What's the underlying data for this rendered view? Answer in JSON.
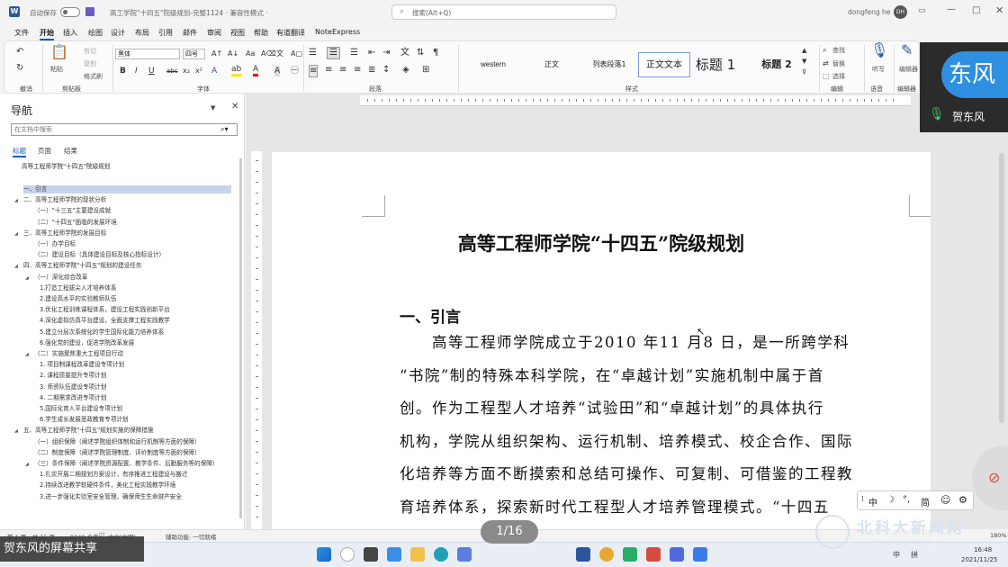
{
  "titlebar": {
    "autosave_label": "自动保存",
    "autosave_state": "关",
    "doc_title": "高工学院\"十四五\"院级规划-完整1124  ·  兼容性模式  ·",
    "search_placeholder": "搜索(Alt+Q)",
    "user_name": "dongfeng he",
    "user_initials": "DH"
  },
  "menu": [
    "文件",
    "开始",
    "插入",
    "绘图",
    "设计",
    "布局",
    "引用",
    "邮件",
    "审阅",
    "视图",
    "帮助",
    "有道翻译",
    "NoteExpress"
  ],
  "menu_active": "开始",
  "ribbon": {
    "undo_group": "撤消",
    "clipboard": {
      "paste": "粘贴",
      "cut": "剪切",
      "copy": "复制",
      "format_painter": "格式刷",
      "label": "剪贴板"
    },
    "font": {
      "name": "黑体",
      "size": "四号",
      "label": "字体",
      "bold": "B",
      "italic": "I",
      "underline": "U",
      "strike": "abc",
      "sub": "x₂",
      "sup": "x²"
    },
    "paragraph": {
      "label": "段落"
    },
    "styles": {
      "label": "样式",
      "items": [
        "western",
        "正文",
        "列表段落1",
        "正文文本",
        "标题 1",
        "标题 2"
      ],
      "selected": "正文文本"
    },
    "editing": {
      "find": "查找",
      "replace": "替换",
      "select": "选择",
      "label": "编辑"
    },
    "voice": {
      "dictate": "听写",
      "label": "语音"
    },
    "editor": {
      "label": "编辑器",
      "btn": "编辑器"
    }
  },
  "nav": {
    "title": "导航",
    "search_placeholder": "在文档中搜索",
    "tabs": [
      "标题",
      "页面",
      "结果"
    ],
    "active_tab": "标题",
    "items": [
      {
        "text": "高等工程师学院\"十四五\"院级规划",
        "level": 0,
        "tri": ""
      },
      {
        "text": "一、引言",
        "level": 1,
        "tri": "",
        "selected": true
      },
      {
        "text": "二、高等工程师学院的现状分析",
        "level": 1,
        "tri": "◢"
      },
      {
        "text": "（一）\"十三五\"主要建设成就",
        "level": 2,
        "tri": ""
      },
      {
        "text": "（二）\"十四五\"面临的发展环境",
        "level": 2,
        "tri": ""
      },
      {
        "text": "三、高等工程师学院的发展目标",
        "level": 1,
        "tri": "◢"
      },
      {
        "text": "（一）办学目标",
        "level": 2,
        "tri": ""
      },
      {
        "text": "（二）建设目标（具体建设目标及核心指标设计）",
        "level": 2,
        "tri": ""
      },
      {
        "text": "四、高等工程师学院\"十四五\"规划的建设任务",
        "level": 1,
        "tri": "◢"
      },
      {
        "text": "（一）深化综合改革",
        "level": 2,
        "tri": "◢"
      },
      {
        "text": "1.打造工程拔尖人才培养体系",
        "level": 3,
        "tri": ""
      },
      {
        "text": "2.建设高水平的实验教师队伍",
        "level": 3,
        "tri": ""
      },
      {
        "text": "3.优化工程训练课程体系，建设工程实践创新平台",
        "level": 3,
        "tri": ""
      },
      {
        "text": "4.深化虚拟仿真平台建设，全面支撑工程实践教学",
        "level": 3,
        "tri": ""
      },
      {
        "text": "5.建立分层次系统化的学生国际化能力培养体系",
        "level": 3,
        "tri": ""
      },
      {
        "text": "6.强化党的建设，促进学院改革发展",
        "level": 3,
        "tri": ""
      },
      {
        "text": "（二）实施聚焦重大工程项目行动",
        "level": 2,
        "tri": "◢"
      },
      {
        "text": "1. 项目制课程改革建设专项计划",
        "level": 3,
        "tri": ""
      },
      {
        "text": "2. 课程质量提升专项计划",
        "level": 3,
        "tri": ""
      },
      {
        "text": "3. 师资队伍建设专项计划",
        "level": 3,
        "tri": ""
      },
      {
        "text": "4. 二期需求改进专项计划",
        "level": 3,
        "tri": ""
      },
      {
        "text": "5.国际化育人平台建设专项计划",
        "level": 3,
        "tri": ""
      },
      {
        "text": "6.学生成长发展思政教育专项计划",
        "level": 3,
        "tri": ""
      },
      {
        "text": "五、高等工程师学院\"十四五\"规划实施的保障措施",
        "level": 1,
        "tri": "◢"
      },
      {
        "text": "（一）组织保障（阐述学院组织体制和运行机制等方面的保障）",
        "level": 2,
        "tri": ""
      },
      {
        "text": "（二）制度保障（阐述学院管理制度、评价制度等方面的保障）",
        "level": 2,
        "tri": ""
      },
      {
        "text": "（三）条件保障（阐述学院资源配置、教学条件、后勤服务等的保障）",
        "level": 2,
        "tri": "◢"
      },
      {
        "text": "1.扎实开展二期规划方案设计，有序推进工程建设与搬迁",
        "level": 3,
        "tri": ""
      },
      {
        "text": "2.持续改进教学软硬件条件，美化工程实践教学环境",
        "level": 3,
        "tri": ""
      },
      {
        "text": "3.进一步强化实验室安全管理，确保师生生命财产安全",
        "level": 3,
        "tri": ""
      }
    ]
  },
  "document": {
    "title": "高等工程师学院“十四五”院级规划",
    "heading": "一、引言",
    "lines": [
      "　　高等工程师学院成立于2010 年11 月8 日，是一所跨学科",
      "“书院”制的特殊本科学院，在“卓越计划”实施机制中属于首",
      "创。作为工程型人才培养“试验田”和“卓越计划”的具体执行",
      "机构，学院从组织架构、运行机制、培养模式、校企合作、国际",
      "化培养等方面不断摸索和总结可操作、可复制、可借鉴的工程教",
      "育培养体系，探索新时代工程型人才培养管理模式。“十四五"
    ]
  },
  "status": {
    "page": "第 1 页，共 15 页",
    "words": "9240 个字",
    "lang": "中文(中国)",
    "accessibility": "辅助功能: 一切就绪"
  },
  "overlay": {
    "share": "贺东风的屏幕共享",
    "pager": "1/16",
    "avatar_text": "东风",
    "speaker": "贺东风",
    "watermark": "北科大新闻网",
    "watermark_url": "http://news.ustb.edu.cn"
  },
  "ime": {
    "mode": "中",
    "punct": "°,",
    "simp": "简"
  },
  "taskbar": {
    "ime_lang": "中",
    "ime_mode": "拼",
    "time": "16:48",
    "date": "2021/11/25",
    "zoom": "180%"
  },
  "colors": {
    "accent": "#185abd",
    "word_blue": "#2b579a",
    "avatar": "#2f8fe0"
  }
}
